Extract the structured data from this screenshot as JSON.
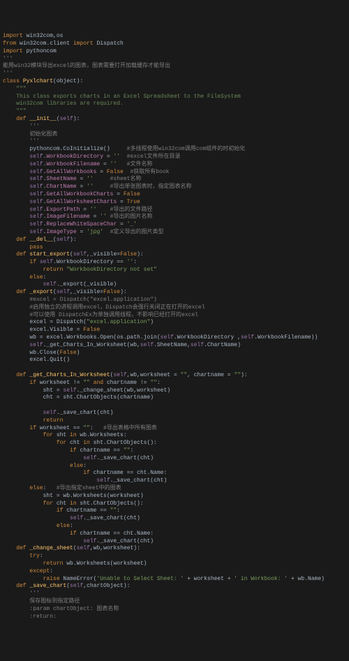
{
  "lines": [
    [
      [
        "kw",
        "import "
      ],
      [
        "mod",
        "win32com"
      ],
      [
        "op",
        ","
      ],
      [
        "mod",
        "os"
      ]
    ],
    [
      [
        "kw",
        "from "
      ],
      [
        "mod",
        "win32com.client"
      ],
      [
        "kw",
        " import "
      ],
      [
        "mod",
        "Dispatch"
      ]
    ],
    [
      [
        "kw",
        "import "
      ],
      [
        "mod",
        "pythoncom"
      ]
    ],
    [
      [
        "com",
        "'''"
      ]
    ],
    [
      [
        "com",
        "能用win32模块导出excel的图表，图表需要打开加载缓存才能导出"
      ]
    ],
    [
      [
        "com",
        "'''"
      ]
    ],
    [
      [
        "kw",
        "class "
      ],
      [
        "fn",
        "Pyxlchart"
      ],
      [
        "op",
        "("
      ],
      [
        "id",
        "object"
      ],
      [
        "op",
        "):"
      ]
    ],
    [
      [
        "doc",
        "    \"\"\""
      ]
    ],
    [
      [
        "doc",
        "    This class exports charts in an Excel Spreadsheet to the FileSystem"
      ]
    ],
    [
      [
        "doc",
        "    win32com libraries are required."
      ]
    ],
    [
      [
        "doc",
        "    \"\"\""
      ]
    ],
    [
      [
        "kw",
        "    def "
      ],
      [
        "fn",
        "__init__"
      ],
      [
        "op",
        "("
      ],
      [
        "self",
        "self"
      ],
      [
        "op",
        "):"
      ]
    ],
    [
      [
        "com",
        "        '''"
      ]
    ],
    [
      [
        "com",
        "        初始化图表"
      ]
    ],
    [
      [
        "com",
        "        '''"
      ]
    ],
    [
      [
        "id",
        "        pythoncom.CoInitialize()     "
      ],
      [
        "com",
        "#多线程使用win32com调用com组件的时初始化"
      ]
    ],
    [
      [
        "self",
        "        self"
      ],
      [
        "op",
        "."
      ],
      [
        "pink",
        "WorkbookDirectory"
      ],
      [
        "op",
        " = "
      ],
      [
        "str",
        "''"
      ],
      [
        "com",
        "  #excel文件所在目录"
      ]
    ],
    [
      [
        "self",
        "        self"
      ],
      [
        "op",
        "."
      ],
      [
        "pink",
        "WorkbookFilename"
      ],
      [
        "op",
        " = "
      ],
      [
        "str",
        "''"
      ],
      [
        "com",
        "   #文件名称"
      ]
    ],
    [
      [
        "self",
        "        self"
      ],
      [
        "op",
        "."
      ],
      [
        "pink",
        "GetAllWorkbooks"
      ],
      [
        "op",
        " = "
      ],
      [
        "bool",
        "False"
      ],
      [
        "com",
        "  #获取所有book"
      ]
    ],
    [
      [
        "self",
        "        self"
      ],
      [
        "op",
        "."
      ],
      [
        "pink",
        "SheetName"
      ],
      [
        "op",
        " = "
      ],
      [
        "str",
        "''"
      ],
      [
        "com",
        "     #sheet名称"
      ]
    ],
    [
      [
        "self",
        "        self"
      ],
      [
        "op",
        "."
      ],
      [
        "pink",
        "ChartName"
      ],
      [
        "op",
        " = "
      ],
      [
        "str",
        "''"
      ],
      [
        "com",
        "     #导出单张图表时，指定图表名称"
      ]
    ],
    [
      [
        "self",
        "        self"
      ],
      [
        "op",
        "."
      ],
      [
        "pink",
        "GetAllWorkbookCharts"
      ],
      [
        "op",
        " = "
      ],
      [
        "bool",
        "False"
      ]
    ],
    [
      [
        "self",
        "        self"
      ],
      [
        "op",
        "."
      ],
      [
        "pink",
        "GetAllWorksheetCharts"
      ],
      [
        "op",
        " = "
      ],
      [
        "bool",
        "True"
      ]
    ],
    [
      [
        "self",
        "        self"
      ],
      [
        "op",
        "."
      ],
      [
        "pink",
        "ExportPath"
      ],
      [
        "op",
        " = "
      ],
      [
        "str",
        "''"
      ],
      [
        "com",
        "    #导出的文件路径"
      ]
    ],
    [
      [
        "self",
        "        self"
      ],
      [
        "op",
        "."
      ],
      [
        "pink",
        "ImageFilename"
      ],
      [
        "op",
        " = "
      ],
      [
        "str",
        "''"
      ],
      [
        "com",
        " #导出的图片名称"
      ]
    ],
    [
      [
        "self",
        "        self"
      ],
      [
        "op",
        "."
      ],
      [
        "pink",
        "ReplaceWhiteSpaceChar"
      ],
      [
        "op",
        " = "
      ],
      [
        "str",
        "'_'"
      ]
    ],
    [
      [
        "self",
        "        self"
      ],
      [
        "op",
        "."
      ],
      [
        "pink",
        "ImageType"
      ],
      [
        "op",
        " = "
      ],
      [
        "str",
        "'jpg'"
      ],
      [
        "com",
        "  #定义导出的图片类型"
      ]
    ],
    [
      [
        "kw",
        "    def "
      ],
      [
        "fn",
        "__del__"
      ],
      [
        "op",
        "("
      ],
      [
        "self",
        "self"
      ],
      [
        "op",
        "):"
      ]
    ],
    [
      [
        "kw",
        "        pass"
      ]
    ],
    [
      [
        "kw",
        "    def "
      ],
      [
        "fn",
        "start_export"
      ],
      [
        "op",
        "("
      ],
      [
        "self",
        "self"
      ],
      [
        "op",
        ","
      ],
      [
        "par",
        "_visible"
      ],
      [
        "op",
        "="
      ],
      [
        "bool",
        "False"
      ],
      [
        "op",
        "):"
      ]
    ],
    [
      [
        "kw",
        "        if "
      ],
      [
        "self",
        "self"
      ],
      [
        "op",
        ".WorkbookDirectory == "
      ],
      [
        "str",
        "''"
      ],
      [
        "op",
        ":"
      ]
    ],
    [
      [
        "kw",
        "            return "
      ],
      [
        "str",
        "\"WorkbookDirectory not set\""
      ]
    ],
    [
      [
        "kw",
        "        else"
      ],
      [
        "op",
        ":"
      ]
    ],
    [
      [
        "self",
        "            self"
      ],
      [
        "op",
        "._export(_visible)"
      ]
    ],
    [
      [
        "kw",
        "    def "
      ],
      [
        "fn",
        "_export"
      ],
      [
        "op",
        "("
      ],
      [
        "self",
        "self"
      ],
      [
        "op",
        ","
      ],
      [
        "par",
        "_visible"
      ],
      [
        "op",
        "="
      ],
      [
        "bool",
        "False"
      ],
      [
        "op",
        "):"
      ]
    ],
    [
      [
        "com",
        "        #excel = Dispatch(\"excel.application\")"
      ]
    ],
    [
      [
        "com",
        "        #启用独立的进程调用excel，Dispatch会强行关闭正在打开的excel"
      ]
    ],
    [
      [
        "com",
        "        #可以使用 DispatchEx为单独调用线程，不影响已经打开的excel"
      ]
    ],
    [
      [
        "id",
        "        excel = Dispatch("
      ],
      [
        "str",
        "\"excel.application\""
      ],
      [
        "id",
        ")"
      ]
    ],
    [
      [
        "id",
        "        excel.Visible = "
      ],
      [
        "bool",
        "False"
      ]
    ],
    [
      [
        "id",
        "        wb = excel.Workbooks.Open(os.path.join("
      ],
      [
        "self",
        "self"
      ],
      [
        "id",
        ".WorkbookDirectory ,"
      ],
      [
        "self",
        "self"
      ],
      [
        "id",
        ".WorkbookFilename))"
      ]
    ],
    [
      [
        "self",
        "        self"
      ],
      [
        "id",
        "._get_Charts_In_Worksheet(wb,"
      ],
      [
        "self",
        "self"
      ],
      [
        "id",
        ".SheetName,"
      ],
      [
        "self",
        "self"
      ],
      [
        "id",
        ".ChartName)"
      ]
    ],
    [
      [
        "id",
        "        wb.Close("
      ],
      [
        "bool",
        "False"
      ],
      [
        "id",
        ")"
      ]
    ],
    [
      [
        "id",
        "        excel.Quit()"
      ]
    ],
    [
      [
        "id",
        ""
      ]
    ],
    [
      [
        "kw",
        "    def "
      ],
      [
        "fn",
        "_get_Charts_In_Worksheet"
      ],
      [
        "op",
        "("
      ],
      [
        "self",
        "self"
      ],
      [
        "op",
        ","
      ],
      [
        "par",
        "wb"
      ],
      [
        "op",
        ","
      ],
      [
        "par",
        "worksheet"
      ],
      [
        "op",
        " = "
      ],
      [
        "str",
        "\"\""
      ],
      [
        "op",
        ", "
      ],
      [
        "par",
        "chartname"
      ],
      [
        "op",
        " = "
      ],
      [
        "str",
        "\"\""
      ],
      [
        "op",
        "):"
      ]
    ],
    [
      [
        "kw",
        "        if "
      ],
      [
        "id",
        "worksheet != "
      ],
      [
        "str",
        "\"\""
      ],
      [
        "kw",
        " and "
      ],
      [
        "id",
        "chartname != "
      ],
      [
        "str",
        "\"\""
      ],
      [
        "op",
        ":"
      ]
    ],
    [
      [
        "id",
        "            sht = "
      ],
      [
        "self",
        "self"
      ],
      [
        "id",
        "._change_sheet(wb,worksheet)"
      ]
    ],
    [
      [
        "id",
        "            cht = sht.ChartObjects(chartname)"
      ]
    ],
    [
      [
        "id",
        ""
      ]
    ],
    [
      [
        "self",
        "            self"
      ],
      [
        "id",
        "._save_chart(cht)"
      ]
    ],
    [
      [
        "kw",
        "            return"
      ]
    ],
    [
      [
        "kw",
        "        if "
      ],
      [
        "id",
        "worksheet == "
      ],
      [
        "str",
        "\"\""
      ],
      [
        "op",
        ":   "
      ],
      [
        "com",
        "#导出表格中所有图表"
      ]
    ],
    [
      [
        "kw",
        "            for "
      ],
      [
        "id",
        "sht "
      ],
      [
        "kw",
        "in "
      ],
      [
        "id",
        "wb.Worksheets:"
      ]
    ],
    [
      [
        "kw",
        "                for "
      ],
      [
        "id",
        "cht "
      ],
      [
        "kw",
        "in "
      ],
      [
        "id",
        "sht.ChartObjects():"
      ]
    ],
    [
      [
        "kw",
        "                    if "
      ],
      [
        "id",
        "chartname == "
      ],
      [
        "str",
        "\"\""
      ],
      [
        "op",
        ":"
      ]
    ],
    [
      [
        "self",
        "                        self"
      ],
      [
        "id",
        "._save_chart(cht)"
      ]
    ],
    [
      [
        "kw",
        "                    else"
      ],
      [
        "op",
        ":"
      ]
    ],
    [
      [
        "kw",
        "                        if "
      ],
      [
        "id",
        "chartname == cht.Name:"
      ]
    ],
    [
      [
        "self",
        "                            self"
      ],
      [
        "id",
        "._save_chart(cht)"
      ]
    ],
    [
      [
        "kw",
        "        else"
      ],
      [
        "op",
        ":   "
      ],
      [
        "com",
        "#导出指定sheet中的图表"
      ]
    ],
    [
      [
        "id",
        "            sht = wb.Worksheets(worksheet)"
      ]
    ],
    [
      [
        "kw",
        "            for "
      ],
      [
        "id",
        "cht "
      ],
      [
        "kw",
        "in "
      ],
      [
        "id",
        "sht.ChartObjects():"
      ]
    ],
    [
      [
        "kw",
        "                if "
      ],
      [
        "id",
        "chartname == "
      ],
      [
        "str",
        "\"\""
      ],
      [
        "op",
        ":"
      ]
    ],
    [
      [
        "self",
        "                    self"
      ],
      [
        "id",
        "._save_chart(cht)"
      ]
    ],
    [
      [
        "kw",
        "                else"
      ],
      [
        "op",
        ":"
      ]
    ],
    [
      [
        "kw",
        "                    if "
      ],
      [
        "id",
        "chartname == cht.Name:"
      ]
    ],
    [
      [
        "self",
        "                        self"
      ],
      [
        "id",
        "._save_chart(cht)"
      ]
    ],
    [
      [
        "kw",
        "    def "
      ],
      [
        "fn",
        "_change_sheet"
      ],
      [
        "op",
        "("
      ],
      [
        "self",
        "self"
      ],
      [
        "op",
        ","
      ],
      [
        "par",
        "wb"
      ],
      [
        "op",
        ","
      ],
      [
        "par",
        "worksheet"
      ],
      [
        "op",
        "):"
      ]
    ],
    [
      [
        "kw",
        "        try"
      ],
      [
        "op",
        ":"
      ]
    ],
    [
      [
        "kw",
        "            return "
      ],
      [
        "id",
        "wb.Worksheets(worksheet)"
      ]
    ],
    [
      [
        "kw",
        "        except"
      ],
      [
        "op",
        ":"
      ]
    ],
    [
      [
        "kw",
        "            raise "
      ],
      [
        "err",
        "NameError"
      ],
      [
        "op",
        "("
      ],
      [
        "str",
        "'Unable to Select Sheet: '"
      ],
      [
        "op",
        " + worksheet + "
      ],
      [
        "str",
        "' in Workbook: '"
      ],
      [
        "op",
        " + wb.Name)"
      ]
    ],
    [
      [
        "kw",
        "    def "
      ],
      [
        "fn",
        "_save_chart"
      ],
      [
        "op",
        "("
      ],
      [
        "self",
        "self"
      ],
      [
        "op",
        ","
      ],
      [
        "par",
        "chartObject"
      ],
      [
        "op",
        "):"
      ]
    ],
    [
      [
        "com",
        "        '''"
      ]
    ],
    [
      [
        "com",
        "        保存图标到指定路径"
      ]
    ],
    [
      [
        "com",
        "        :param chartObject: 图表名称"
      ]
    ],
    [
      [
        "com",
        "        :return:"
      ]
    ]
  ]
}
